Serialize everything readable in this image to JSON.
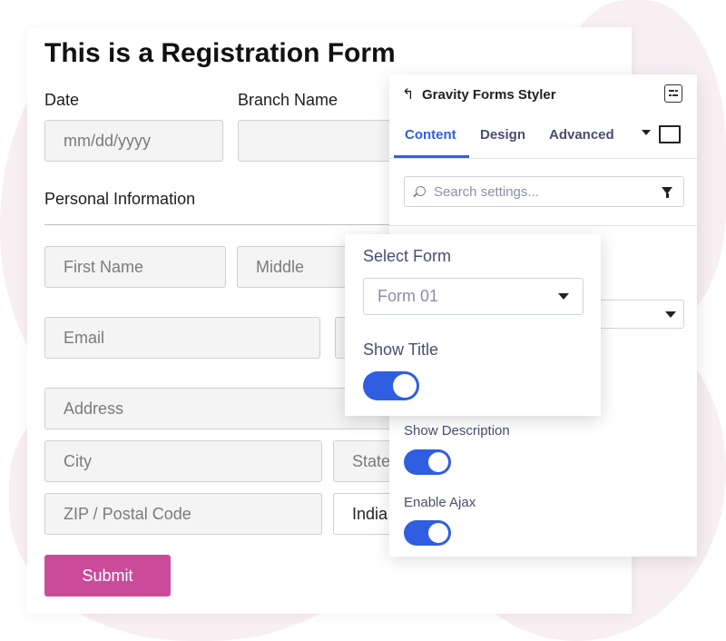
{
  "form": {
    "title": "This is a Registration Form",
    "date_label": "Date",
    "date_placeholder": "mm/dd/yyyy",
    "branch_label": "Branch Name",
    "branch_value": "",
    "section_title": "Personal Information",
    "first_name_placeholder": "First Name",
    "middle_placeholder": "Middle",
    "email_placeholder": "Email",
    "address_placeholder": "Address",
    "city_placeholder": "City",
    "state_placeholder": "State",
    "zip_placeholder": "ZIP / Postal Code",
    "country_value": "India",
    "submit_label": "Submit",
    "submit_color": "#cb4b9a"
  },
  "panel": {
    "title": "Gravity Forms Styler",
    "tabs": [
      {
        "label": "Content",
        "active": true
      },
      {
        "label": "Design",
        "active": false
      },
      {
        "label": "Advanced",
        "active": false
      }
    ],
    "search_placeholder": "Search settings...",
    "show_description_label": "Show Description",
    "show_description_on": true,
    "enable_ajax_label": "Enable Ajax",
    "enable_ajax_on": true,
    "accent_color": "#2f5fe0"
  },
  "popup": {
    "select_form_label": "Select Form",
    "select_form_value": "Form 01",
    "show_title_label": "Show Title",
    "show_title_on": true
  },
  "icons": [
    "back-arrow-icon",
    "panel-menu-icon",
    "dropdown-arrow-icon",
    "device-icon",
    "search-icon",
    "filter-icon",
    "chevron-down-icon"
  ]
}
